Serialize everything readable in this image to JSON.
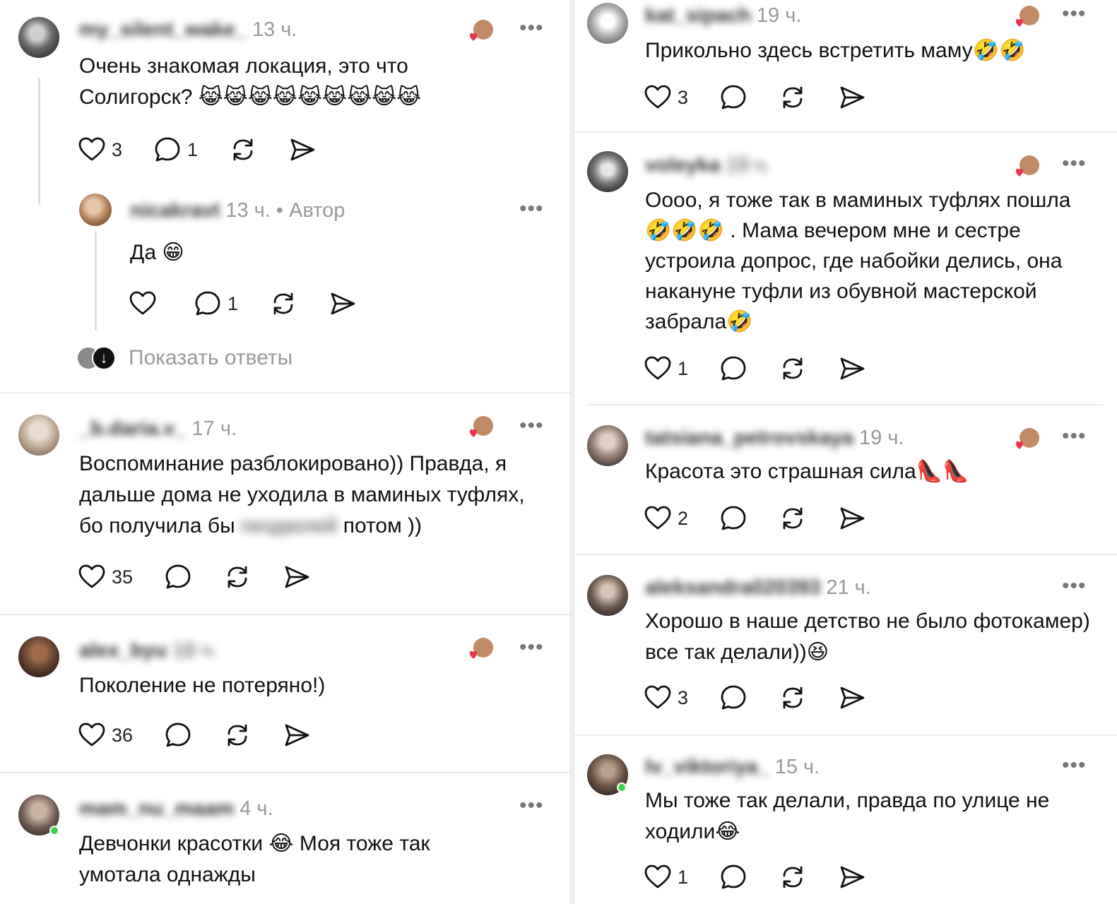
{
  "left_posts": [
    {
      "username": "my_silent_wake_",
      "time": "13 ч.",
      "text_lines": [
        "Очень знакомая локация, это что",
        "Солигорск? 😹😹😹😹😹😹😹😹😹"
      ],
      "likes": "3",
      "replies": "1",
      "reply": {
        "username": "nicakravt",
        "time": "13 ч.",
        "author_label": "• Автор",
        "text": "Да 😁",
        "replies": "1"
      },
      "show_replies_label": "Показать ответы"
    },
    {
      "username": "_b.daria.v_",
      "time": "17 ч.",
      "text_lines": [
        "Воспоминание разблокировано)) Правда, я",
        "дальше дома не уходила в маминых туфлях,",
        "бо получила бы"
      ],
      "text_blurred": "пиздюлей",
      "text_end": "потом ))",
      "likes": "35"
    },
    {
      "username": "alex_byu",
      "time": "18 ч.",
      "text_lines": [
        "Поколение не потеряно!)"
      ],
      "likes": "36"
    },
    {
      "username": "mam_nu_maam",
      "time": "4 ч.",
      "text_lines": [
        "Девчонки красотки 😂 Моя тоже так",
        "умотала однажды"
      ]
    }
  ],
  "right_posts": [
    {
      "username": "kat_sipach",
      "time": "19 ч.",
      "text_lines": [
        "Прикольно здесь встретить маму🤣🤣"
      ],
      "likes": "3"
    },
    {
      "username": "voleyka",
      "time": "19 ч.",
      "text_lines": [
        "Оооо, я тоже так в маминых туфлях пошла",
        "🤣🤣🤣 . Мама вечером мне и сестре",
        "устроила допрос, где набойки делись, она",
        "накануне туфли из обувной мастерской",
        "забрала🤣"
      ],
      "likes": "1"
    },
    {
      "username": "tatsiana_petrovskaya",
      "time": "19 ч.",
      "text_lines": [
        "Красота это страшная сила👠👠"
      ],
      "likes": "2"
    },
    {
      "username": "aleksandra020393",
      "time": "21 ч.",
      "text_lines": [
        "Хорошо в наше детство не было фотокамер)",
        "все так делали))😆"
      ],
      "likes": "3"
    },
    {
      "username": "lv_viktoriya_",
      "time": "15 ч.",
      "text_lines": [
        "Мы тоже так делали, правда по улице не",
        "ходили😂"
      ],
      "likes": "1"
    }
  ],
  "icons": {
    "like": "heart-icon",
    "comment": "comment-bubble-icon",
    "repost": "repost-icon",
    "share": "send-icon",
    "more": "more-dots-icon",
    "reaction": "author-liked-reaction-icon"
  },
  "colors": {
    "text": "#111111",
    "muted": "#9a9a9a",
    "separator": "#ececec",
    "reaction_heart": "#e8364e",
    "online": "#3ccf4e"
  }
}
